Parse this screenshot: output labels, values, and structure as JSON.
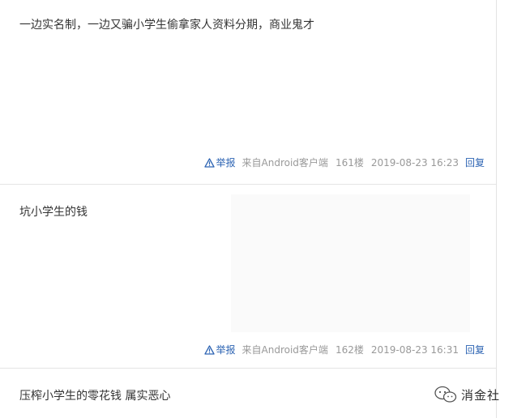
{
  "posts": [
    {
      "text": "一边实名制，一边又骗小学生偷拿家人资料分期，商业鬼才",
      "report": "举报",
      "source": "来自Android客户端",
      "floor": "161楼",
      "time": "2019-08-23 16:23",
      "reply": "回复"
    },
    {
      "text": "坑小学生的钱",
      "report": "举报",
      "source": "来自Android客户端",
      "floor": "162楼",
      "time": "2019-08-23 16:31",
      "reply": "回复"
    },
    {
      "text": "压榨小学生的零花钱 属实恶心"
    }
  ],
  "watermark": {
    "text": "消金社"
  },
  "colors": {
    "link": "#2d64b3",
    "meta": "#999999",
    "text": "#333333",
    "divider": "#e5e5e5"
  },
  "icons": {
    "report": "warning-triangle-icon",
    "watermark": "wechat-logo-icon"
  }
}
